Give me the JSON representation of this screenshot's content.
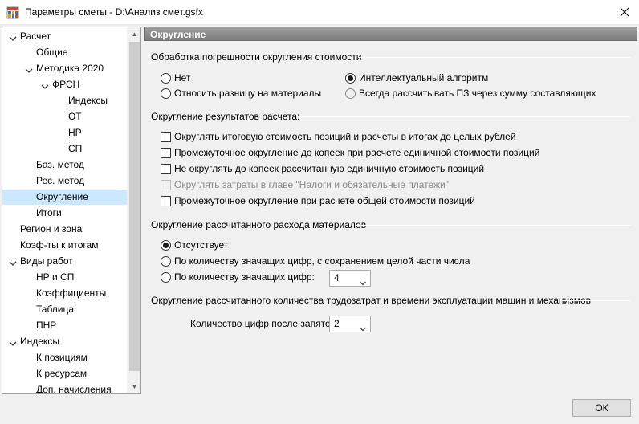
{
  "window": {
    "title": "Параметры сметы - D:\\Анализ смет.gsfx",
    "icon": "grid-app-icon"
  },
  "tree": {
    "items": [
      {
        "label": "Расчет",
        "level": 0,
        "expanded": true
      },
      {
        "label": "Общие",
        "level": 1
      },
      {
        "label": "Методика 2020",
        "level": 1,
        "expanded": true
      },
      {
        "label": "ФРСН",
        "level": 2,
        "expanded": true
      },
      {
        "label": "Индексы",
        "level": 3
      },
      {
        "label": "ОТ",
        "level": 3
      },
      {
        "label": "НР",
        "level": 3
      },
      {
        "label": "СП",
        "level": 3
      },
      {
        "label": "Баз. метод",
        "level": 1
      },
      {
        "label": "Рес. метод",
        "level": 1
      },
      {
        "label": "Округление",
        "level": 1,
        "selected": true
      },
      {
        "label": "Итоги",
        "level": 1
      },
      {
        "label": "Регион и зона",
        "level": 0
      },
      {
        "label": "Коэф-ты к итогам",
        "level": 0
      },
      {
        "label": "Виды работ",
        "level": 0,
        "expanded": true
      },
      {
        "label": "НР и СП",
        "level": 1
      },
      {
        "label": "Коэффициенты",
        "level": 1
      },
      {
        "label": "Таблица",
        "level": 1
      },
      {
        "label": "ПНР",
        "level": 1
      },
      {
        "label": "Индексы",
        "level": 0,
        "expanded": true
      },
      {
        "label": "К позициям",
        "level": 1
      },
      {
        "label": "К ресурсам",
        "level": 1
      },
      {
        "label": "Доп. начисления",
        "level": 1
      }
    ]
  },
  "panel": {
    "header": "Округление",
    "group1": {
      "title": "Обработка погрешности округления стоимости",
      "options": [
        {
          "label": "Нет",
          "checked": false
        },
        {
          "label": "Относить разницу на материалы",
          "checked": false
        },
        {
          "label": "Интеллектуальный алгоритм",
          "checked": true
        },
        {
          "label": "Всегда рассчитывать ПЗ через сумму составляющих",
          "checked": false
        }
      ]
    },
    "group2": {
      "title": "Округление результатов расчета:",
      "options": [
        {
          "label": "Округлять итоговую стоимость позиций и расчеты в итогах до целых рублей",
          "checked": false,
          "disabled": false
        },
        {
          "label": "Промежуточное округление до копеек при расчете единичной стоимости позиций",
          "checked": false,
          "disabled": false
        },
        {
          "label": "Не округлять до копеек рассчитанную единичную стоимость позиций",
          "checked": false,
          "disabled": false
        },
        {
          "label": "Округлять затраты в главе \"Налоги и обязательные платежи\"",
          "checked": false,
          "disabled": true
        },
        {
          "label": "Промежуточное округление при расчете общей стоимости позиций",
          "checked": false,
          "disabled": false
        }
      ]
    },
    "group3": {
      "title": "Округление рассчитанного расхода материалов",
      "options": [
        {
          "label": "Отсутствует",
          "checked": true
        },
        {
          "label": "По количеству значащих цифр, с сохранением целой части числа",
          "checked": false
        },
        {
          "label": "По количеству значащих цифр:",
          "checked": false
        }
      ],
      "digits_value": "4"
    },
    "group4": {
      "title": "Округление рассчитанного количества трудозатрат и времени эксплуатации машин и механизмов",
      "digits_label": "Количество цифр после запятой:",
      "digits_value": "2"
    }
  },
  "footer": {
    "ok_label": "ОК"
  }
}
